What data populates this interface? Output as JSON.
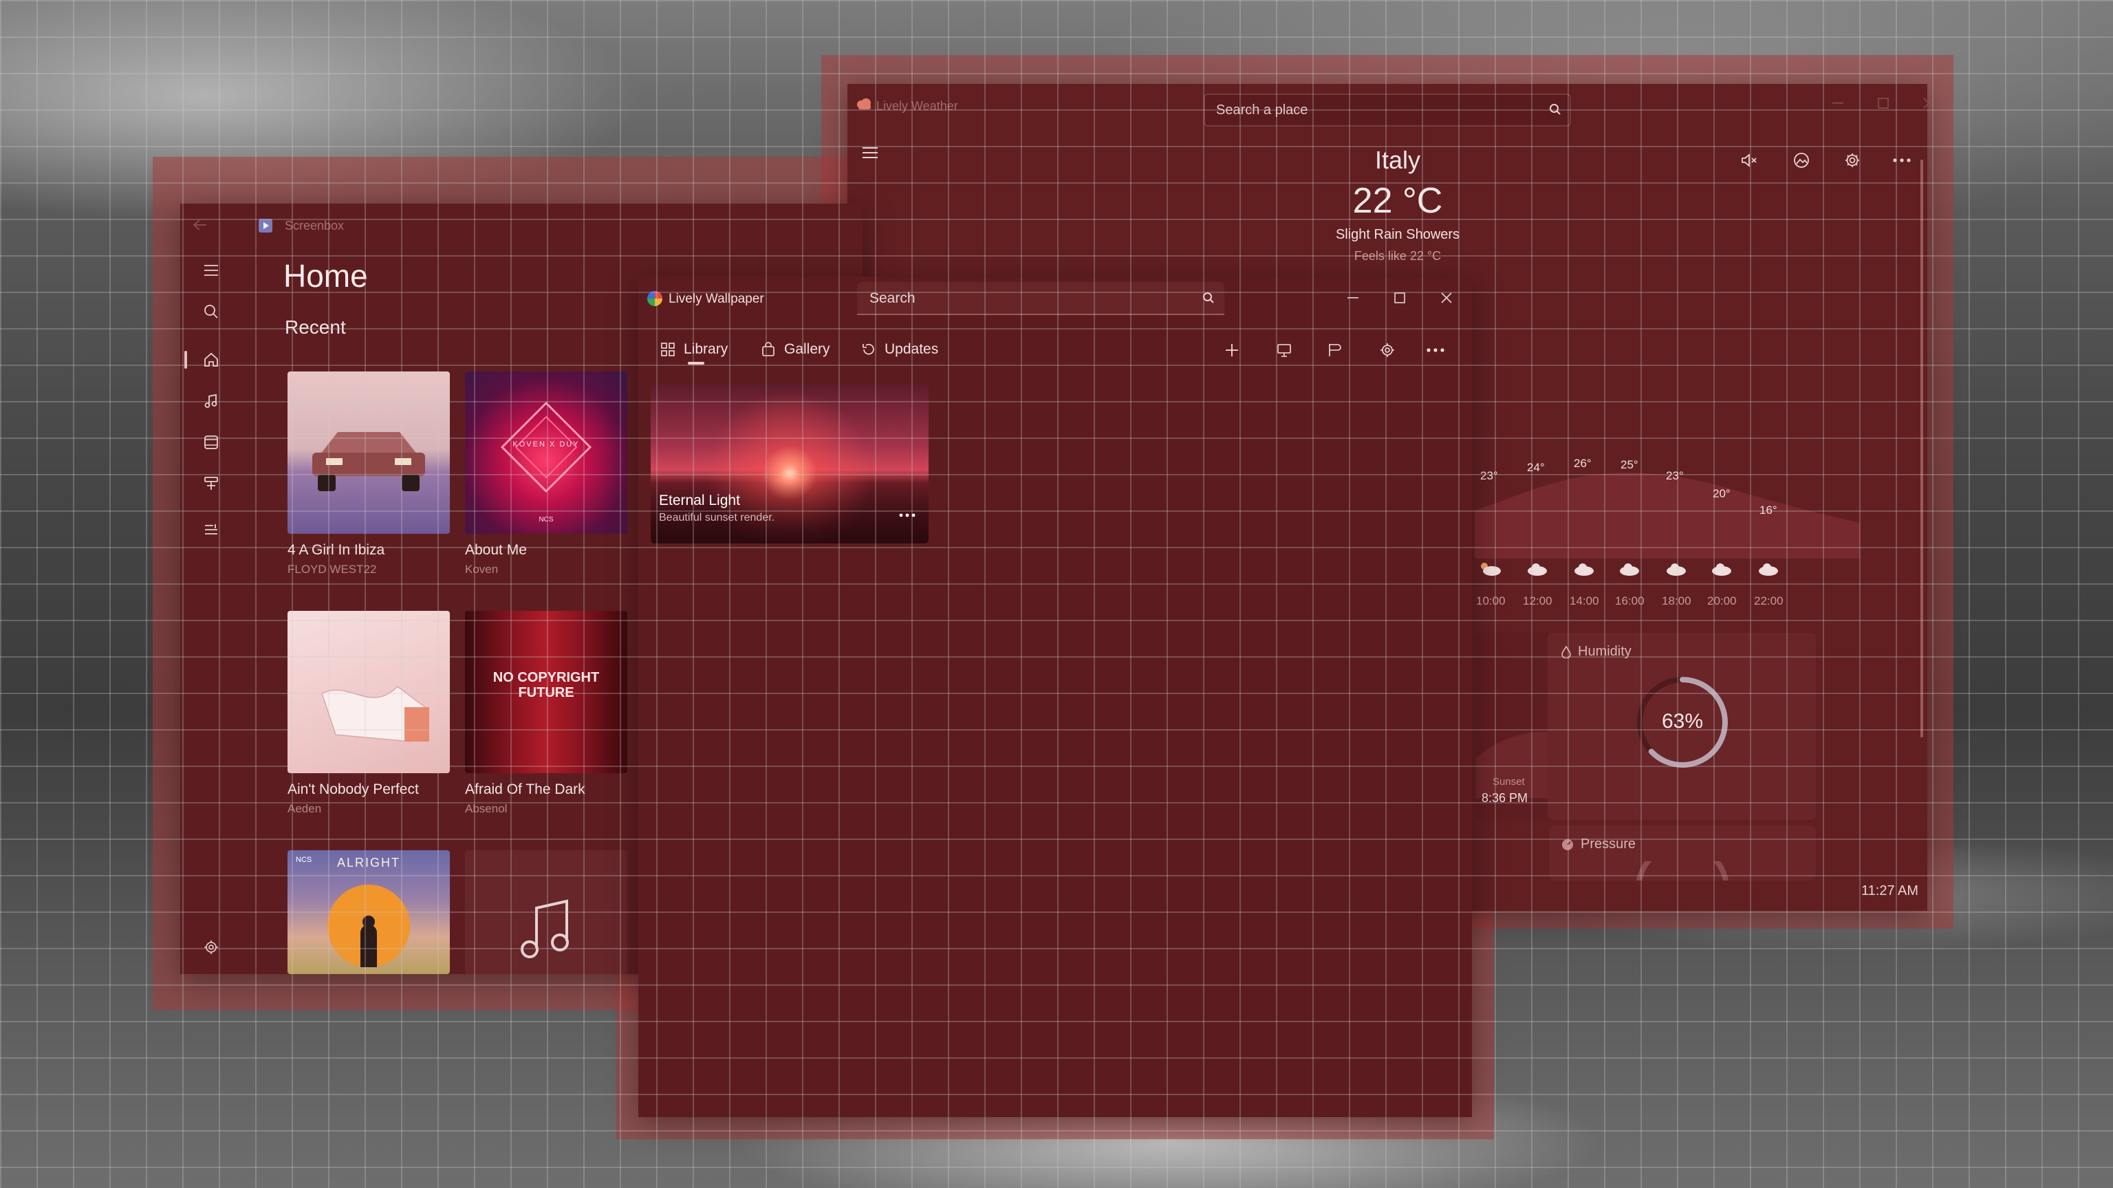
{
  "weather_app": {
    "title": "Lively Weather",
    "search_placeholder": "Search a place",
    "city": "Italy",
    "temperature": "22 °C",
    "condition": "Slight Rain Showers",
    "feels_like": "Feels like 22 °C",
    "hourly": {
      "temps": [
        "23°",
        "24°",
        "26°",
        "25°",
        "23°",
        "20°",
        "16°"
      ],
      "times": [
        "10:00",
        "12:00",
        "14:00",
        "16:00",
        "18:00",
        "20:00",
        "22:00"
      ]
    },
    "sunset_label": "Sunset",
    "sunset_time": "8:36 PM",
    "humidity_title": "Humidity",
    "humidity_value": "63%",
    "humidity_fraction": 0.63,
    "pressure_title": "Pressure",
    "clock": "11:27 AM"
  },
  "screenbox": {
    "title": "Screenbox",
    "page_title": "Home",
    "section_title": "Recent",
    "albums": [
      {
        "title": "4 A Girl In Ibiza",
        "artist": "FLOYD WEST22"
      },
      {
        "title": "About Me",
        "artist": "Koven"
      },
      {
        "title": "Ain't Nobody Perfect",
        "artist": "Aeden"
      },
      {
        "title": "Afraid Of The Dark",
        "artist": "Absenol"
      },
      {
        "title": "",
        "artist": ""
      },
      {
        "title": "",
        "artist": ""
      }
    ],
    "art_text": {
      "about_me": "KOVEN X DUY",
      "ncs": "NCS",
      "afraid": "NO COPYRIGHT FUTURE",
      "alright": "ALRIGHT"
    }
  },
  "lively": {
    "title": "Lively Wallpaper",
    "search_placeholder": "Search",
    "tabs": [
      "Library",
      "Gallery",
      "Updates"
    ],
    "wallpaper": {
      "title": "Eternal Light",
      "description": "Beautiful sunset render."
    }
  }
}
